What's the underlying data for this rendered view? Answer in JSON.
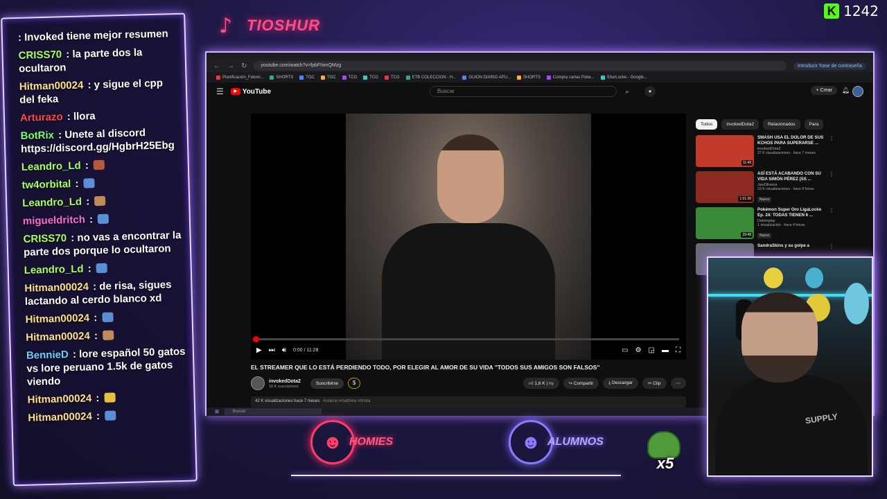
{
  "brand": {
    "name": "TIOSHUR"
  },
  "kick": {
    "count": "1242"
  },
  "chat": [
    {
      "user": "",
      "text": "Invoked tiene mejor resumen",
      "color": "#ffffff"
    },
    {
      "user": "CRISS70",
      "text": "la parte dos la ocultaron",
      "color": "#a8ff60"
    },
    {
      "user": "Hitman00024",
      "text": "y sigue el cpp del feka",
      "color": "#ffe08a"
    },
    {
      "user": "Arturazo",
      "text": "llora",
      "color": "#ff4a4a"
    },
    {
      "user": "BotRix",
      "text": "Unete al discord https://discord.gg/HgbrH25Ebg",
      "color": "#7cff6b"
    },
    {
      "user": "Leandro_Ld",
      "text": "",
      "color": "#a8ff60"
    },
    {
      "user": "tw4orbital",
      "text": "",
      "color": "#a8ff60"
    },
    {
      "user": "Leandro_Ld",
      "text": "",
      "color": "#a8ff60"
    },
    {
      "user": "migueldritch",
      "text": "",
      "color": "#ff6bd6"
    },
    {
      "user": "CRISS70",
      "text": "no vas a encontrar la parte dos porque lo ocultaron",
      "color": "#a8ff60"
    },
    {
      "user": "Leandro_Ld",
      "text": "",
      "color": "#a8ff60"
    },
    {
      "user": "Hitman00024",
      "text": "de risa, sigues lactando al cerdo blanco xd",
      "color": "#ffe08a"
    },
    {
      "user": "Hitman00024",
      "text": "",
      "color": "#ffe08a"
    },
    {
      "user": "Hitman00024",
      "text": "",
      "color": "#ffe08a"
    },
    {
      "user": "BennieD",
      "text": "lore español 50 gatos vs lore peruano 1.5k de gatos viendo",
      "color": "#6bd0ff"
    },
    {
      "user": "Hitman00024",
      "text": "",
      "color": "#ffe08a"
    },
    {
      "user": "Hitman00024",
      "text": "",
      "color": "#ffe08a"
    }
  ],
  "browser": {
    "url": "youtube.com/watch?v=fpbFhimQMzg",
    "password_prompt": "Introducir frase de contraseña",
    "bookmarks": [
      "Planificación_Febrer...",
      "SHORTS",
      "TGC",
      "TGC",
      "TCG",
      "TCG",
      "TCG",
      "ETB COLECCION - H...",
      "GUION DIARIO APU...",
      "SHORTS",
      "Compra cartas Poke...",
      "ShurLocke - Google..."
    ]
  },
  "youtube": {
    "logo": "YouTube",
    "search_placeholder": "Buscar",
    "create": "+ Crear",
    "player_time": "0:00 / 11:28",
    "progress": 0,
    "video_title": "EL STREAMER QUE LO ESTÁ PERDIENDO TODO, POR ELEGIR AL AMOR DE SU VIDA \"TODOS SUS AMIGOS SON FALSOS\"",
    "channel_name": "invokedDota2",
    "channel_subs": "18 K suscriptores",
    "subscribe": "Suscribirse",
    "likes": "1,6 K",
    "share": "Compartir",
    "download": "Descargar",
    "clip": "Clip",
    "desc_meta": "42 K visualizaciones  hace 7 meses",
    "desc_tags": "#sideral #matthew #timba",
    "chips": [
      "Todos",
      "invokedDota2",
      "Relacionados",
      "Para"
    ],
    "recs": [
      {
        "title": "SMASH USA EL DOLOR DE SUS KCHOS PARA SUPERARSE ...",
        "channel": "invokedDota2",
        "views": "37 K visualizaciones · hace 7 meses",
        "badge": "",
        "duration": "11:49",
        "thumb": "#c23b2a"
      },
      {
        "title": "ASÍ ESTÁ ACABANDO CON SU VIDA SIMÓN PÉREZ (SS ...",
        "channel": "JaviOliveira",
        "views": "23 K visualizaciones · hace 8 horas",
        "badge": "Nuevo",
        "duration": "1:01:38",
        "thumb": "#8a2a20"
      },
      {
        "title": "Pokémon Super Oro LigaLocke Ep. 24: TODAS TIENEN 6 ...",
        "channel": "Dekimplay",
        "views": "1 visualización · hace 4 horas",
        "badge": "Nuevo",
        "duration": "29:48",
        "thumb": "#3a8a3a"
      },
      {
        "title": "SandraSkins y su golpe a",
        "channel": "",
        "views": "",
        "badge": "",
        "duration": "",
        "thumb": "#6a6a7a"
      }
    ]
  },
  "taskbar": {
    "search": "Buscar"
  },
  "teams": {
    "left": "HOMIES",
    "right": "ALUMNOS",
    "multiplier": "x5"
  },
  "webcam": {
    "shirt_logo": "SUPPLY"
  }
}
